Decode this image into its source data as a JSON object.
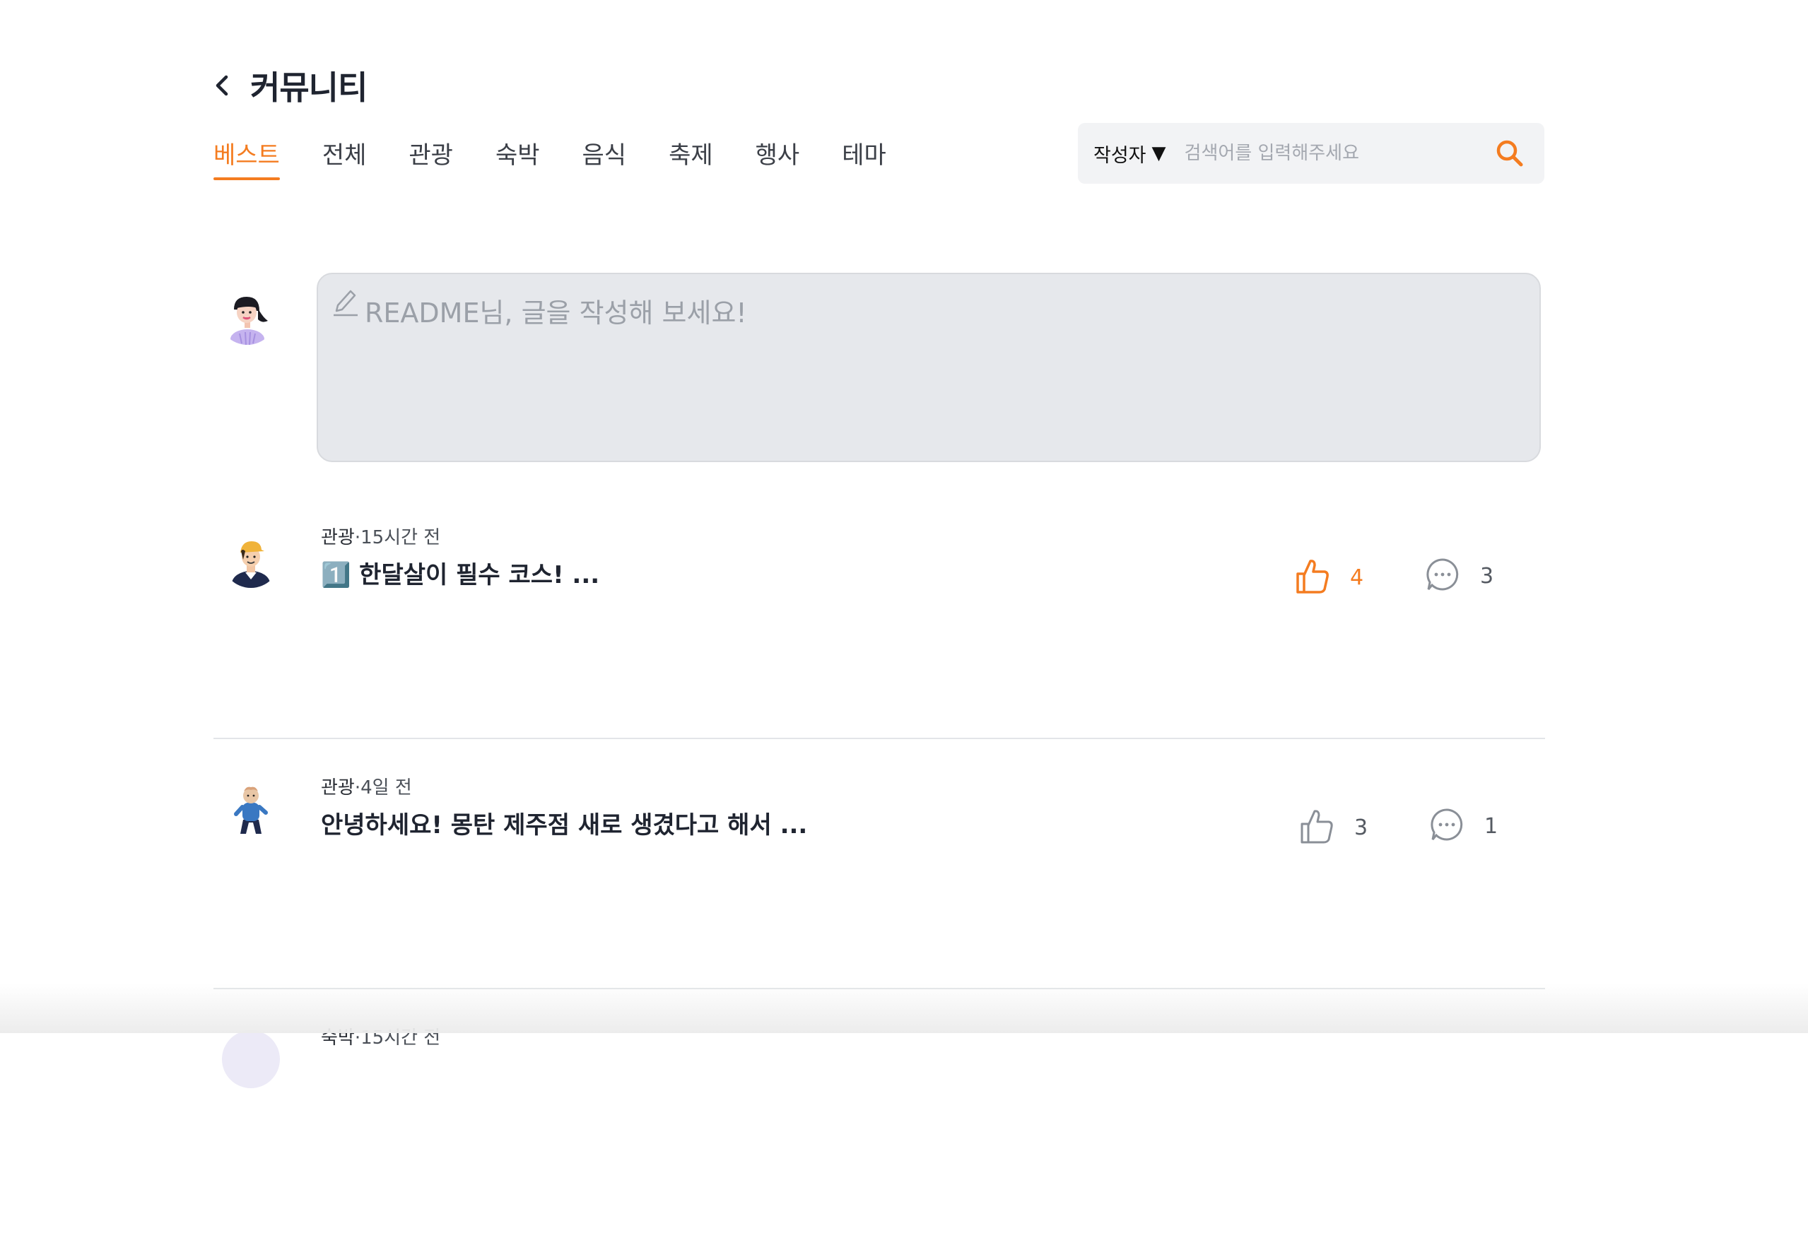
{
  "header": {
    "title": "커뮤니티"
  },
  "tabs": [
    {
      "label": "베스트",
      "active": true
    },
    {
      "label": "전체"
    },
    {
      "label": "관광"
    },
    {
      "label": "숙박"
    },
    {
      "label": "음식"
    },
    {
      "label": "축제"
    },
    {
      "label": "행사"
    },
    {
      "label": "테마"
    }
  ],
  "search": {
    "filter_label": "작성자",
    "filter_arrow": "▼",
    "placeholder": "검색어를 입력해주세요"
  },
  "composer": {
    "placeholder": "README님, 글을 작성해 보세요!"
  },
  "posts": [
    {
      "category": "관광",
      "separator": "·",
      "time": "15시간 전",
      "title": "1️⃣ 한달살이 필수 코스! ...",
      "likes": "4",
      "comments": "3",
      "liked": true
    },
    {
      "category": "관광",
      "separator": "·",
      "time": "4일 전",
      "title": "안녕하세요! 몽탄 제주점 새로 생겼다고 해서 ...",
      "likes": "3",
      "comments": "1",
      "liked": false
    },
    {
      "category": "숙박",
      "separator": "·",
      "time": "15시간 전",
      "title": "",
      "likes": "",
      "comments": "",
      "liked": false
    }
  ],
  "colors": {
    "accent": "#f47c20",
    "text": "#1f2430",
    "muted": "#9ba0a8",
    "composer_bg": "#e6e8ec"
  },
  "icons": [
    "chevron-left-icon",
    "search-icon",
    "pencil-icon",
    "thumbs-up-icon",
    "comment-icon",
    "avatar"
  ]
}
